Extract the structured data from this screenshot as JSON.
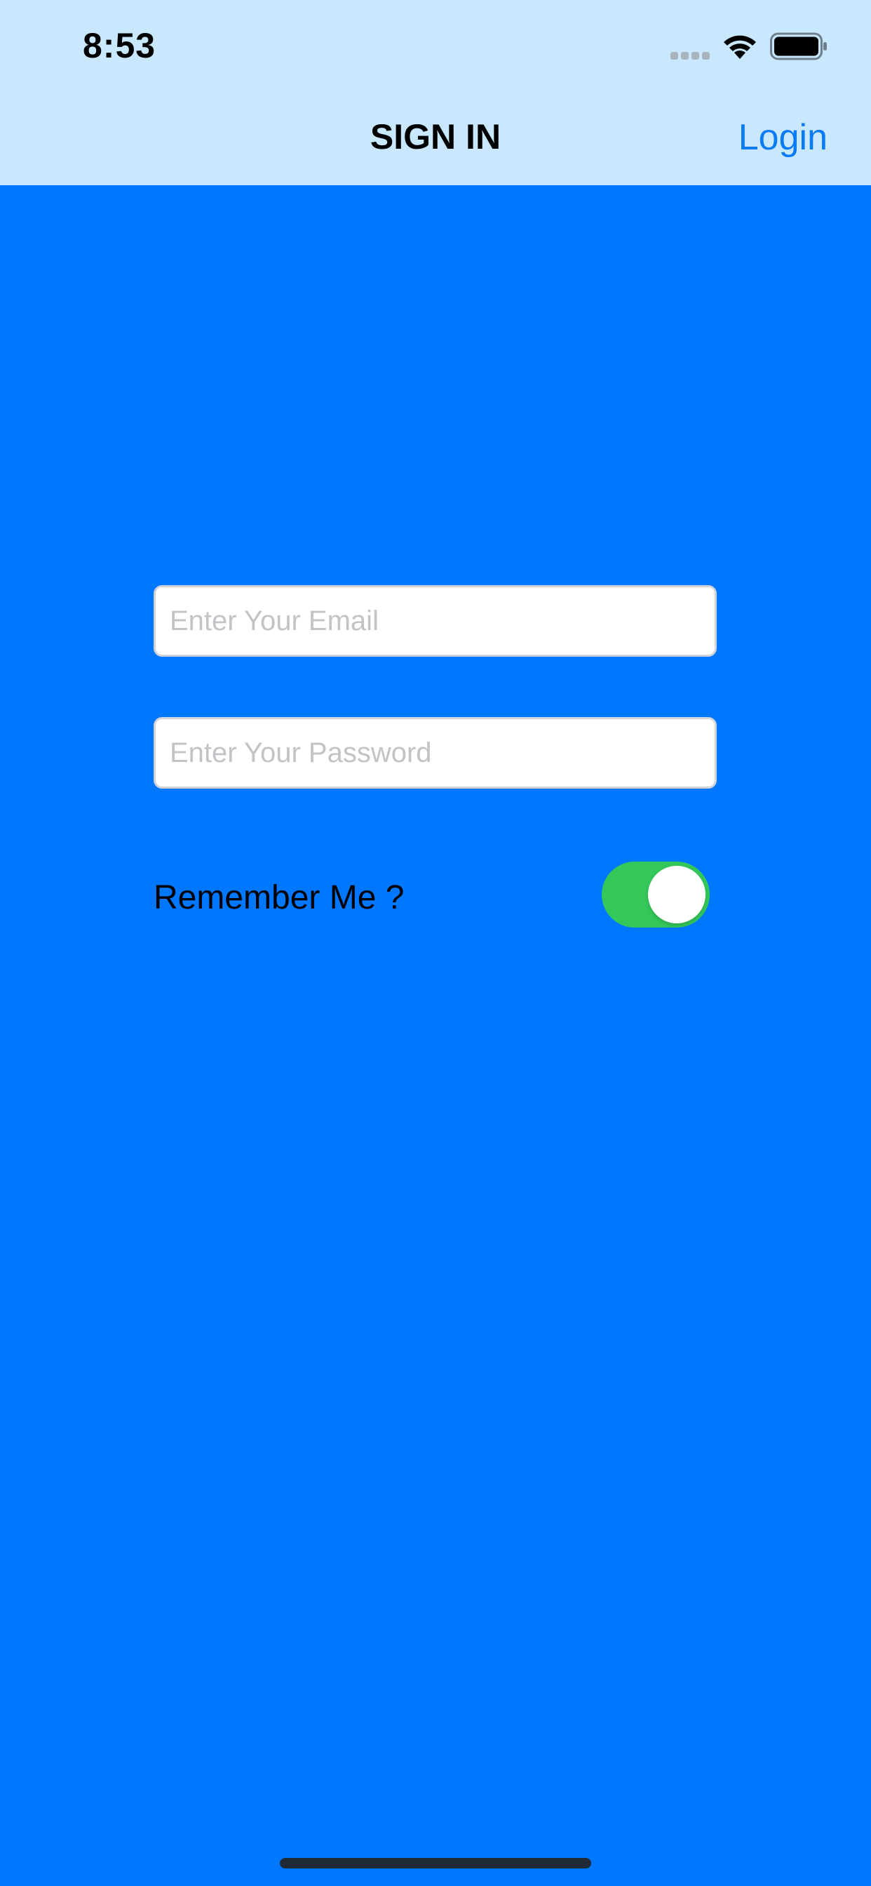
{
  "status_bar": {
    "time": "8:53",
    "icons": [
      "cellular-signal-icon",
      "wifi-icon",
      "battery-icon"
    ]
  },
  "nav_bar": {
    "title": "SIGN IN",
    "right_button_label": "Login"
  },
  "form": {
    "email": {
      "value": "",
      "placeholder": "Enter Your Email"
    },
    "password": {
      "value": "",
      "placeholder": "Enter Your Password"
    },
    "remember_me": {
      "label": "Remember Me ?",
      "on": true
    }
  },
  "colors": {
    "background": "#0077ff",
    "nav_bar": "#c9e8fd",
    "accent_link": "#0a7bf5",
    "toggle_on": "#34c759"
  }
}
